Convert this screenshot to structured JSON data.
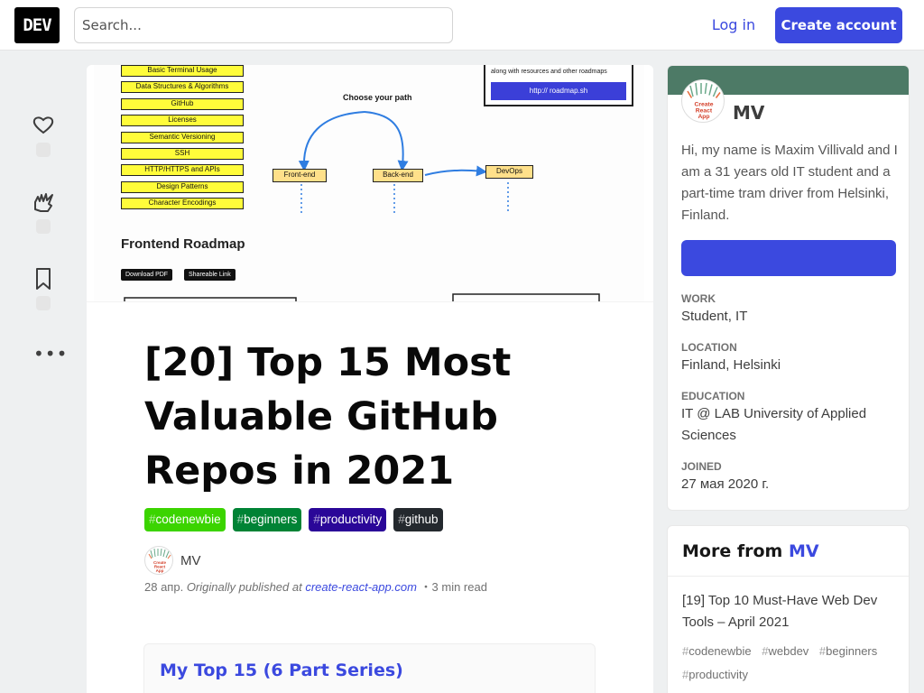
{
  "header": {
    "logo": "DEV",
    "search_placeholder": "Search...",
    "login": "Log in",
    "create_account": "Create account"
  },
  "rail": {
    "icons": [
      "heart-icon",
      "unicorn-icon",
      "bookmark-icon",
      "more-icon"
    ],
    "more": "•••"
  },
  "cover": {
    "topics": [
      "Basic Terminal Usage",
      "Data Structures & Algorithms",
      "GitHub",
      "Licenses",
      "Semantic Versioning",
      "SSH",
      "HTTP/HTTPS and APIs",
      "Design Patterns",
      "Character Encodings"
    ],
    "choose": "Choose your path",
    "paths": [
      "Front-end",
      "Back-end",
      "DevOps"
    ],
    "note": "along with resources and other roadmaps",
    "link": "http:// roadmap.sh",
    "title": "Frontend Roadmap",
    "buttons": [
      "Download PDF",
      "Shareable Link"
    ]
  },
  "article": {
    "title": "[20] Top 15 Most Valuable GitHub Repos in 2021",
    "tags": [
      {
        "hash": "#",
        "name": "codenewbie",
        "color": "#3bd400"
      },
      {
        "hash": "#",
        "name": "beginners",
        "color": "#008335"
      },
      {
        "hash": "#",
        "name": "productivity",
        "color": "#2a0798"
      },
      {
        "hash": "#",
        "name": "github",
        "color": "#24292e"
      }
    ],
    "author": "MV",
    "date": "28 апр.",
    "originally": "Originally published at",
    "source": "create-react-app.com",
    "read_time": "・3 min read",
    "series_title": "My Top 15 (6 Part Series)"
  },
  "avatar_text": "Create React App",
  "profile": {
    "name": "MV",
    "bio": "Hi, my name is Maxim Villivald and I am a 31 years old IT student and a part-time tram driver from Helsinki, Finland.",
    "work_label": "Work",
    "work": "Student, IT",
    "location_label": "Location",
    "location": "Finland, Helsinki",
    "education_label": "Education",
    "education": "IT @ LAB University of Applied Sciences",
    "joined_label": "Joined",
    "joined": "27 мая 2020 г.",
    "band_color": "#4d7a66"
  },
  "more_from": {
    "prefix": "More from ",
    "author": "MV",
    "post_title": "[19] Top 10 Must-Have Web Dev Tools – April 2021",
    "tags": [
      "codenewbie",
      "webdev",
      "beginners",
      "productivity"
    ]
  }
}
